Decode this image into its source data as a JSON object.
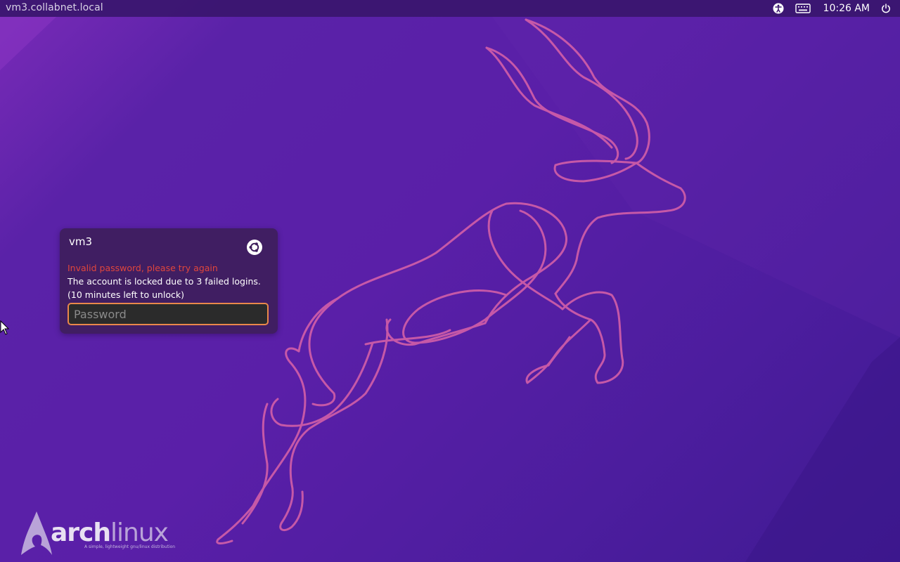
{
  "top_bar": {
    "hostname": "vm3.collabnet.local",
    "clock": "10:26 AM",
    "icons": [
      "accessibility-icon",
      "keyboard-icon",
      "power-icon"
    ]
  },
  "login": {
    "username": "vm3",
    "session_icon": "ubuntu-session-icon",
    "error_message": "Invalid password, please try again",
    "lock_message": "The account is locked due to 3 failed logins.",
    "unlock_message": "(10 minutes left to unlock)",
    "password_placeholder": "Password",
    "password_value": ""
  },
  "branding": {
    "logo_arch": "arch",
    "logo_linux": "linux",
    "tagline": "A simple, lightweight gnu/linux distribution"
  },
  "colors": {
    "background": "#5121a4",
    "error": "#e0463c",
    "input_focus": "#e9884a",
    "wallpaper_line": "#d35fa8"
  }
}
